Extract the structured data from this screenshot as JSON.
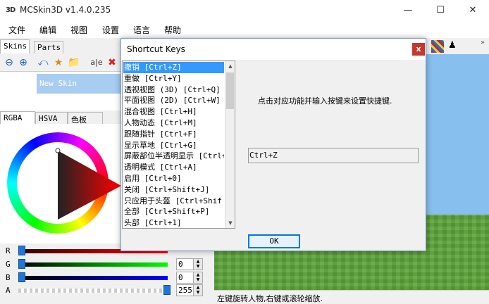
{
  "window": {
    "title": "MCSkin3D v1.4.0.235",
    "icon_text": "3D"
  },
  "menu": [
    "文件",
    "编辑",
    "视图",
    "设置",
    "语言",
    "帮助"
  ],
  "tabs": {
    "skins": "Skins",
    "parts": "Parts"
  },
  "skins": [
    "New Skin"
  ],
  "color_tabs": [
    "RGBA",
    "HSVA",
    "色板"
  ],
  "channels": [
    {
      "label": "R",
      "value": ""
    },
    {
      "label": "G",
      "value": "0"
    },
    {
      "label": "B",
      "value": "0"
    },
    {
      "label": "A",
      "value": "255"
    }
  ],
  "dialog": {
    "title": "Shortcut Keys",
    "items": [
      "撤销 [Ctrl+Z]",
      "重做 [Ctrl+Y]",
      "透视视图 (3D) [Ctrl+Q]",
      "平面视图 (2D) [Ctrl+W]",
      "混合视图 [Ctrl+H]",
      "人物动态 [Ctrl+M]",
      "跟随指针 [Ctrl+F]",
      "显示草地 [Ctrl+G]",
      "屏蔽部位半透明显示 [Ctrl+",
      "透明模式 [Ctrl+A]",
      "启用 [Ctrl+0]",
      "关闭 [Ctrl+Shift+J]",
      "只应用于头盔 [Ctrl+Shif",
      "全部 [Ctrl+Shift+P]",
      "头部 [Ctrl+1]"
    ],
    "selected_index": 0,
    "prompt": "点击对应功能并输入按键来设置快捷键.",
    "field_value": "Ctrl+Z",
    "ok": "OK"
  },
  "status": "左键旋转人物,右键或滚轮缩放."
}
